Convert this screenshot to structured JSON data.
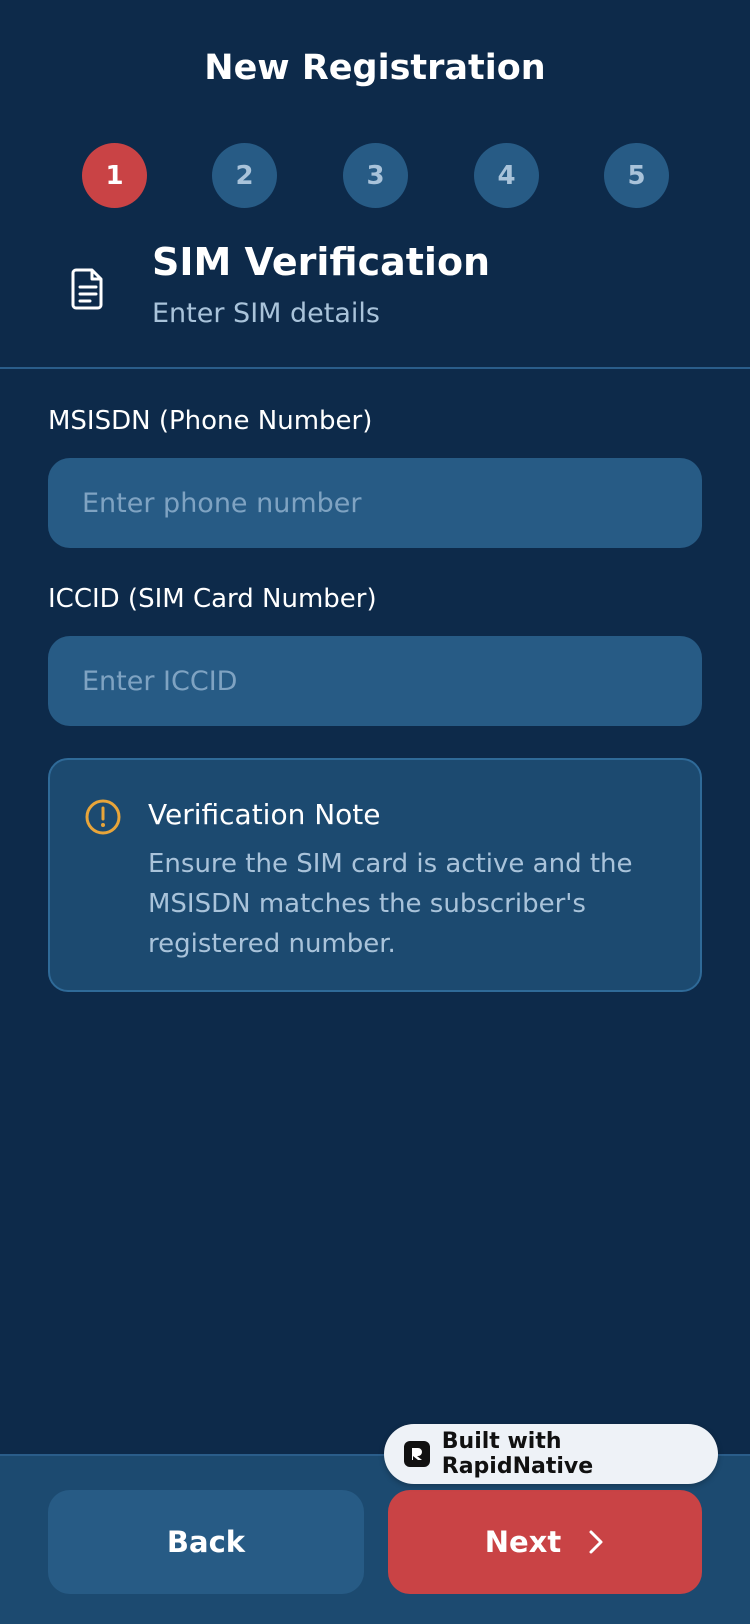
{
  "header": {
    "title": "New Registration"
  },
  "stepper": {
    "steps": [
      "1",
      "2",
      "3",
      "4",
      "5"
    ],
    "active_step": 1
  },
  "section": {
    "icon": "document-icon",
    "title": "SIM Verification",
    "subtitle": "Enter SIM details"
  },
  "form": {
    "msisdn": {
      "label": "MSISDN (Phone Number)",
      "placeholder": "Enter phone number",
      "value": ""
    },
    "iccid": {
      "label": "ICCID (SIM Card Number)",
      "placeholder": "Enter ICCID",
      "value": ""
    }
  },
  "note": {
    "icon": "warning-circle-icon",
    "title": "Verification Note",
    "body": "Ensure the SIM card is active and the MSISDN matches the subscriber's registered number."
  },
  "footer": {
    "back_label": "Back",
    "next_label": "Next"
  },
  "badge": {
    "label": "Built with RapidNative"
  },
  "colors": {
    "background": "#0d2a4a",
    "accent": "#c94345",
    "input": "#275b85",
    "note_bg": "#1c4a70",
    "warning": "#e8a53a",
    "muted_text": "#a9c3da"
  }
}
